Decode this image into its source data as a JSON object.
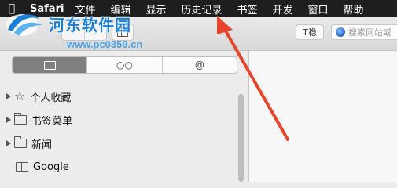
{
  "menubar": {
    "app": "Safari",
    "items": [
      "文件",
      "编辑",
      "显示",
      "历史记录",
      "书签",
      "开发",
      "窗口",
      "帮助"
    ]
  },
  "watermark": {
    "title": "河东软件园",
    "url": "www.pc0359.cn"
  },
  "toolbar": {
    "reader_label": "T稳",
    "search_placeholder": "搜索网站或"
  },
  "sidebar": {
    "tabs": [
      {
        "name": "bookmarks",
        "icon": "book-icon",
        "active": true
      },
      {
        "name": "reading-list",
        "icon": "glasses-icon",
        "label": "○○",
        "active": false
      },
      {
        "name": "shared-links",
        "icon": "at-icon",
        "label": "@",
        "active": false
      }
    ],
    "items": [
      {
        "label": "个人收藏",
        "icon": "star-icon",
        "expandable": true
      },
      {
        "label": "书签菜单",
        "icon": "folder-icon",
        "expandable": true
      },
      {
        "label": "新闻",
        "icon": "folder-icon",
        "expandable": true
      },
      {
        "label": "Google",
        "icon": "book-icon",
        "expandable": false
      }
    ]
  },
  "colors": {
    "menubar_bg": "#1e1e1e",
    "watermark_blue": "#1a7fd6",
    "annotation_arrow": "#e8452c",
    "active_tab_bg": "#7f7f7f"
  }
}
